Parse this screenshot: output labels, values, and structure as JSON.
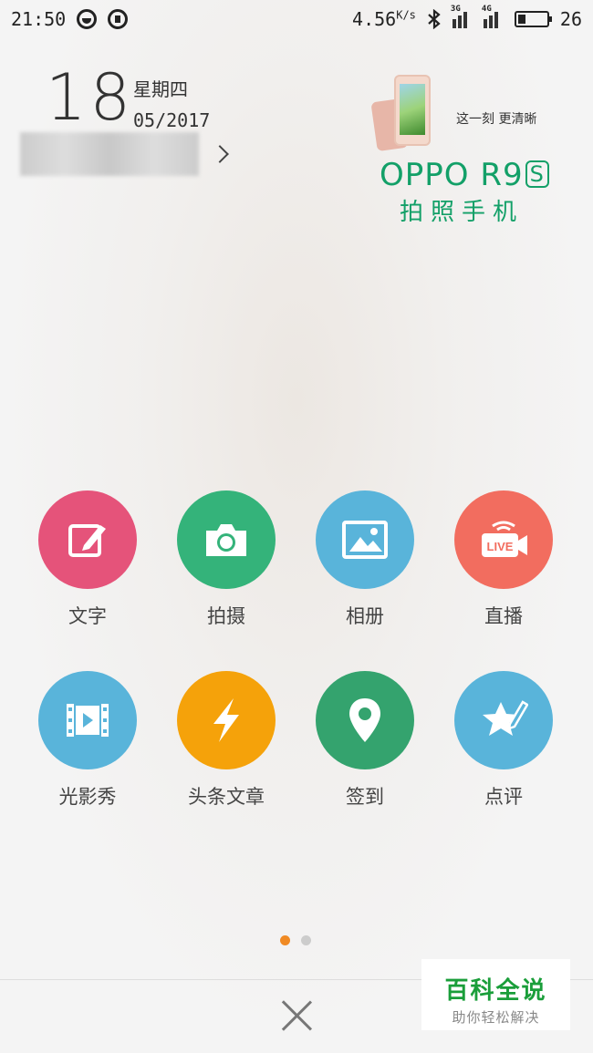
{
  "status_bar": {
    "time": "21:50",
    "net_speed": "4.56",
    "net_speed_unit": "K/s",
    "sim1_type": "3G",
    "sim2_type": "4G",
    "battery_level": "26"
  },
  "date": {
    "day": "18",
    "weekday": "星期四",
    "month_year": "05/2017"
  },
  "ad": {
    "slogan": "这一刻  更清晰",
    "brand": "OPPO R9",
    "brand_suffix": "S",
    "subtitle": "拍照手机"
  },
  "actions": [
    {
      "label": "文字",
      "icon": "edit-icon",
      "color": "#e5537a"
    },
    {
      "label": "拍摄",
      "icon": "camera-icon",
      "color": "#34b37a"
    },
    {
      "label": "相册",
      "icon": "image-icon",
      "color": "#59b4da"
    },
    {
      "label": "直播",
      "icon": "live-icon",
      "color": "#f26d5f",
      "badge": "LIVE"
    },
    {
      "label": "光影秀",
      "icon": "video-icon",
      "color": "#59b4da"
    },
    {
      "label": "头条文章",
      "icon": "lightning-icon",
      "color": "#f5a20a"
    },
    {
      "label": "签到",
      "icon": "location-pin-icon",
      "color": "#34a36e"
    },
    {
      "label": "点评",
      "icon": "star-pen-icon",
      "color": "#59b4da"
    }
  ],
  "pager": {
    "pages": 2,
    "active": 1
  },
  "watermark": {
    "title": "百科全说",
    "subtitle": "助你轻松解决"
  }
}
